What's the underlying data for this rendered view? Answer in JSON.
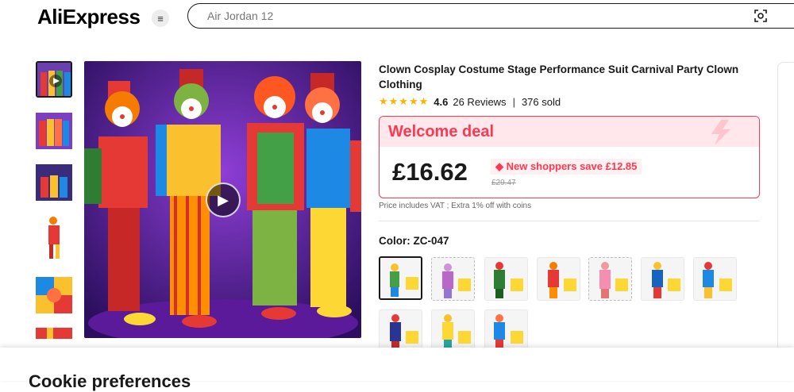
{
  "header": {
    "logo_text": "AliExpress",
    "search_placeholder": "Air Jordan 12"
  },
  "product": {
    "title": "Clown Cosplay Costume Stage Performance Suit Carnival Party Clown Clothing",
    "rating": "4.6",
    "stars": "★★★★★",
    "reviews": "26 Reviews",
    "sold": "376 sold",
    "deal_label": "Welcome deal",
    "price": "£16.62",
    "new_shopper_save": "New shoppers save £12.85",
    "original_price": "£29.47",
    "vat_note": "Price includes VAT ; Extra 1% off with coins",
    "color_label": "Color: ZC-047"
  },
  "colors": {
    "accent": "#fd384f",
    "star": "#f7b500"
  },
  "cookie": {
    "title": "Cookie preferences"
  }
}
